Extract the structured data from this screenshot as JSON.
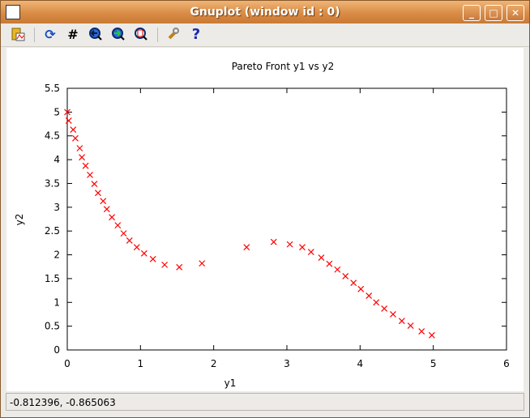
{
  "window": {
    "title": "Gnuplot (window id : 0)",
    "minimize": "_",
    "maximize": "□",
    "close": "✕"
  },
  "toolbar": {
    "icons": [
      "copy-clipboard-icon",
      "replot-icon",
      "grid-icon",
      "zoom-previous-icon",
      "zoom-next-icon",
      "autoscale-icon",
      "options-icon",
      "help-icon"
    ],
    "glyphs": {
      "replot": "⟳",
      "grid": "#",
      "help": "?",
      "options": "🔧"
    }
  },
  "status": {
    "coords": "-0.812396, -0.865063"
  },
  "chart_data": {
    "type": "scatter",
    "title": "Pareto Front y1 vs y2",
    "xlabel": "y1",
    "ylabel": "y2",
    "xlim": [
      0,
      6
    ],
    "ylim": [
      0,
      5.5
    ],
    "xticks": [
      "0",
      "1",
      "2",
      "3",
      "4",
      "5",
      "6"
    ],
    "yticks": [
      "0",
      "0.5",
      "1",
      "1.5",
      "2",
      "2.5",
      "3",
      "3.5",
      "4",
      "4.5",
      "5",
      "5.5"
    ],
    "marker": "x",
    "color": "#ff0000",
    "x": [
      0,
      0.02,
      0.08,
      0.11,
      0.17,
      0.2,
      0.25,
      0.31,
      0.37,
      0.42,
      0.49,
      0.54,
      0.61,
      0.69,
      0.77,
      0.85,
      0.95,
      1.05,
      1.17,
      1.33,
      1.53,
      1.84,
      2.45,
      2.82,
      3.04,
      3.21,
      3.33,
      3.47,
      3.58,
      3.69,
      3.8,
      3.91,
      4.01,
      4.12,
      4.22,
      4.33,
      4.45,
      4.57,
      4.69,
      4.84,
      4.98
    ],
    "y": [
      5.0,
      4.82,
      4.63,
      4.45,
      4.24,
      4.05,
      3.87,
      3.68,
      3.49,
      3.3,
      3.13,
      2.96,
      2.79,
      2.62,
      2.45,
      2.3,
      2.16,
      2.03,
      1.91,
      1.79,
      1.74,
      1.82,
      2.16,
      2.27,
      2.22,
      2.16,
      2.06,
      1.94,
      1.81,
      1.69,
      1.55,
      1.41,
      1.28,
      1.14,
      1.0,
      0.87,
      0.75,
      0.61,
      0.51,
      0.39,
      0.31
    ]
  }
}
